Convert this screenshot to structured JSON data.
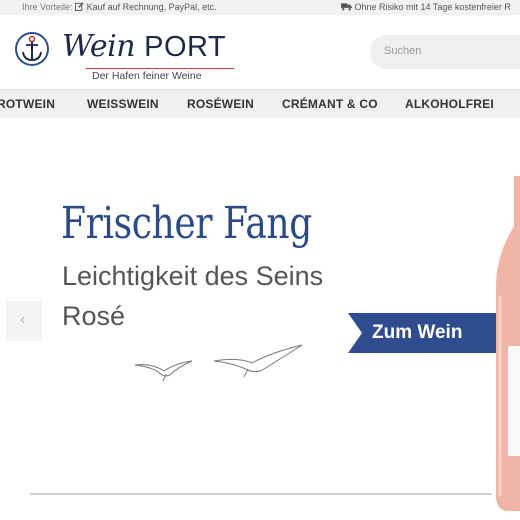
{
  "topbar": {
    "left_prefix": "Ihre Vorteile:",
    "left_text": "Kauf auf Rechnung, PayPal, etc.",
    "right_text": "Ohne Risiko mit 14 Tage kostenfreier R"
  },
  "header": {
    "logo_word1": "Wein",
    "logo_word2": "PORT",
    "tagline": "Der Hafen feiner Weine",
    "search_placeholder": "Suchen"
  },
  "nav": {
    "items": [
      "ROTWEIN",
      "WEISSWEIN",
      "ROSÉWEIN",
      "CRÉMANT & CO",
      "ALKOHOLFREI"
    ]
  },
  "hero": {
    "title": "Frischer Fang",
    "subtitle_line1": "Leichtigkeit des Seins",
    "subtitle_line2": "Rosé",
    "cta_label": "Zum Wein",
    "prev_arrow": "‹"
  },
  "colors": {
    "brand_blue": "#2f4d8e",
    "title_blue": "#2a4a8a",
    "logo_navy": "#1f2a4a",
    "rose": "#efb6a8"
  },
  "icons": [
    "edit-icon",
    "truck-icon",
    "anchor-logo-icon",
    "seagull-illustration",
    "wine-bottle-image"
  ]
}
